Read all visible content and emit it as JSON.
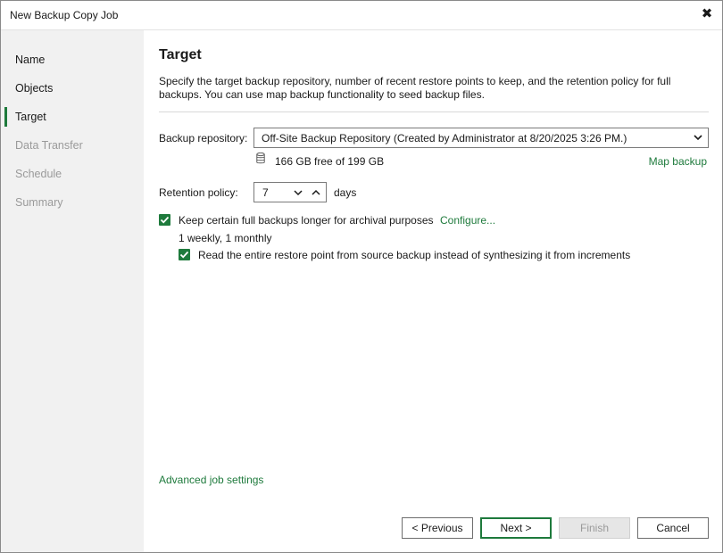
{
  "window": {
    "title": "New Backup Copy Job",
    "close_icon": "close-icon"
  },
  "sidebar": {
    "items": [
      {
        "label": "Name",
        "state": "completed"
      },
      {
        "label": "Objects",
        "state": "completed"
      },
      {
        "label": "Target",
        "state": "active"
      },
      {
        "label": "Data Transfer",
        "state": "disabled"
      },
      {
        "label": "Schedule",
        "state": "disabled"
      },
      {
        "label": "Summary",
        "state": "disabled"
      }
    ]
  },
  "main": {
    "title": "Target",
    "description": "Specify the target backup repository, number of recent restore points to keep, and the retention policy for full backups. You can use map backup functionality to seed backup files.",
    "repository": {
      "label": "Backup repository:",
      "value": "Off-Site Backup Repository (Created by Administrator at 8/20/2025 3:26 PM.)",
      "free_space": "166 GB free of 199 GB",
      "map_backup_link": "Map backup"
    },
    "retention": {
      "label": "Retention policy:",
      "value": "7",
      "unit": "days"
    },
    "archival": {
      "checked": true,
      "label": "Keep certain full backups longer for archival purposes",
      "configure_link": "Configure...",
      "summary": "1 weekly, 1 monthly"
    },
    "read_entire": {
      "checked": true,
      "label": "Read the entire restore point from source backup instead of synthesizing it from increments"
    },
    "advanced_link": "Advanced job settings"
  },
  "footer": {
    "previous_label": "< Previous",
    "next_label": "Next >",
    "finish_label": "Finish",
    "cancel_label": "Cancel"
  },
  "colors": {
    "accent": "#1e7a3c",
    "sidebar_bg": "#f1f1f1",
    "disabled_text": "#9a9a9a"
  }
}
